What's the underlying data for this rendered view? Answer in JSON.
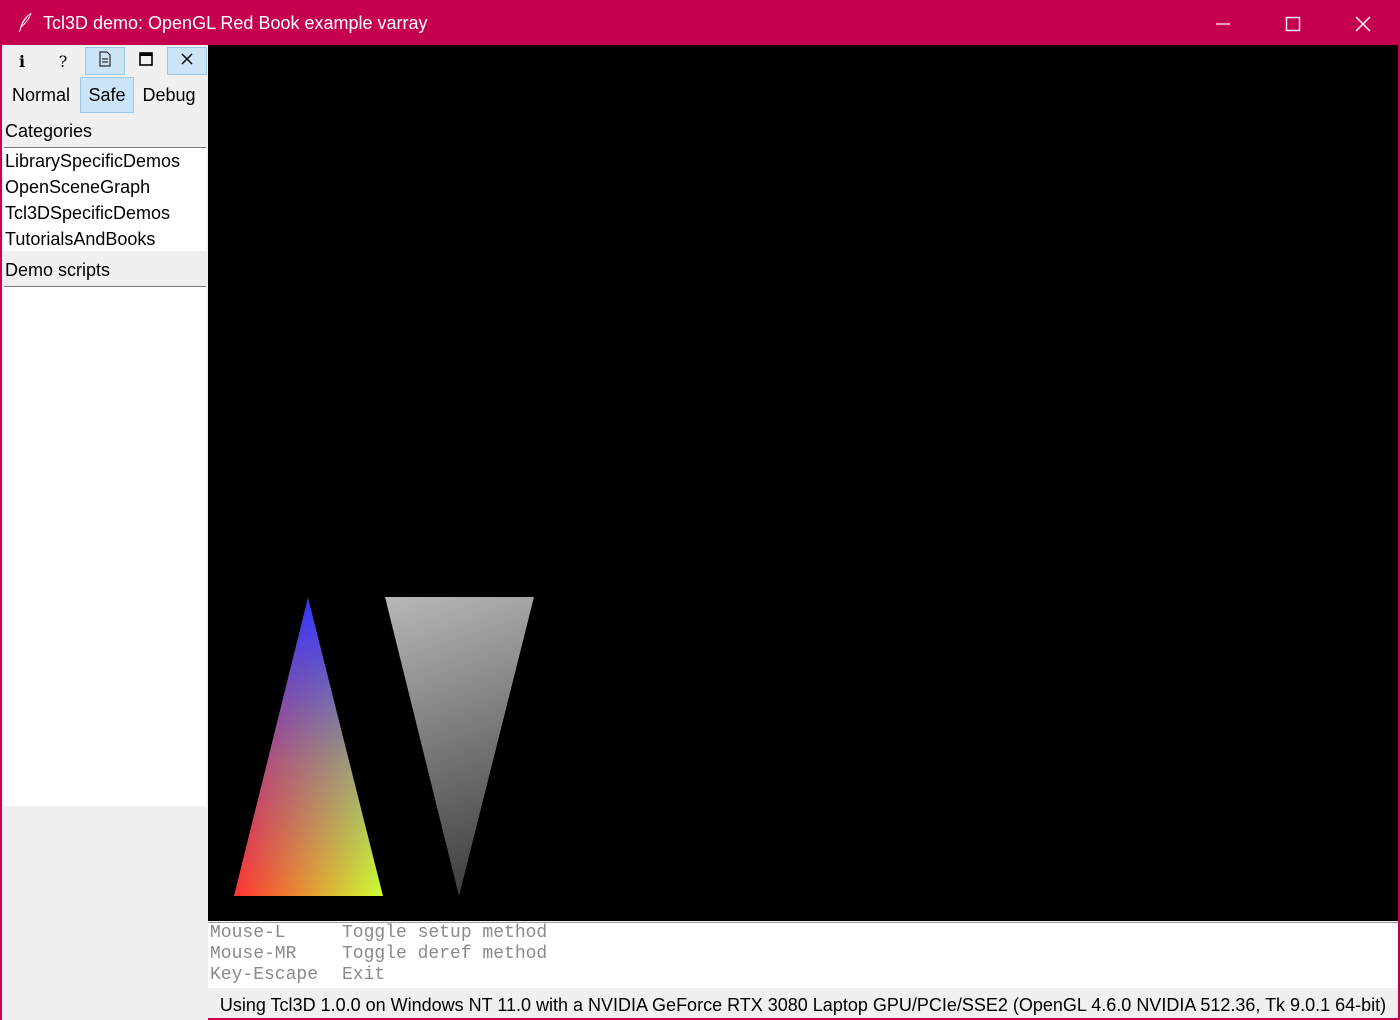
{
  "window": {
    "title": "Tcl3D demo: OpenGL Red Book example varray"
  },
  "toolbar": {
    "buttons": [
      {
        "name": "info",
        "glyph": "i"
      },
      {
        "name": "help",
        "glyph": "?"
      },
      {
        "name": "document",
        "glyph": ""
      },
      {
        "name": "fullscreen",
        "glyph": ""
      },
      {
        "name": "close",
        "glyph": ""
      }
    ],
    "modes": [
      "Normal",
      "Safe",
      "Debug"
    ],
    "active_mode": "Safe"
  },
  "categories": {
    "label": "Categories",
    "items": [
      "LibrarySpecificDemos",
      "OpenSceneGraph",
      "Tcl3DSpecificDemos",
      "TutorialsAndBooks"
    ]
  },
  "demo_scripts": {
    "label": "Demo scripts",
    "items": []
  },
  "help": [
    {
      "key": "Mouse-L",
      "action": "Toggle setup method"
    },
    {
      "key": "Mouse-MR",
      "action": "Toggle deref method"
    },
    {
      "key": "Key-Escape",
      "action": "Exit"
    }
  ],
  "status": "Using Tcl3D 1.0.0 on Windows NT 11.0 with a NVIDIA GeForce RTX 3080 Laptop GPU/PCIe/SSE2 (OpenGL 4.6.0 NVIDIA 512.36, Tk 9.0.1 64-bit)",
  "colors": {
    "titlebar": "#c4004f",
    "selected": "#cce4f7",
    "canvas": "#000000"
  }
}
